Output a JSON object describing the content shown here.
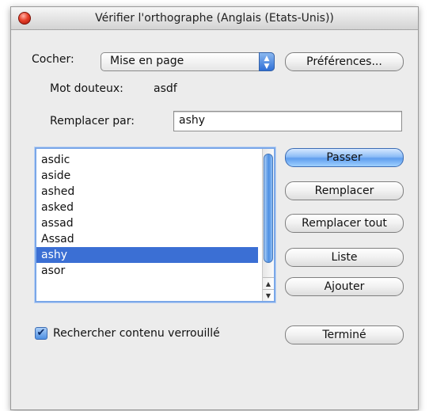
{
  "window": {
    "title": "Vérifier l'orthographe (Anglais (Etats-Unis))"
  },
  "check": {
    "label": "Cocher:",
    "selected": "Mise en page",
    "preferences_label": "Préférences..."
  },
  "doubtful": {
    "label": "Mot douteux:",
    "word": "asdf"
  },
  "replace": {
    "label": "Remplacer par:",
    "value": "ashy"
  },
  "suggestions": {
    "items": [
      "asdic",
      "aside",
      "ashed",
      "asked",
      "assad",
      "Assad",
      "ashy",
      "asor"
    ],
    "selected_index": 6
  },
  "buttons": {
    "skip": "Passer",
    "replace": "Remplacer",
    "replace_all": "Remplacer tout",
    "list": "Liste",
    "add": "Ajouter",
    "done": "Terminé"
  },
  "locked_content": {
    "label": "Rechercher contenu verrouillé",
    "checked": true
  },
  "colors": {
    "accent": "#3b6fd4",
    "default_button": "#5f9eee",
    "close": "#e8402a"
  },
  "icons": {
    "close": "close-icon",
    "popup": "chevron-updown-icon",
    "check": "checkmark-icon"
  }
}
